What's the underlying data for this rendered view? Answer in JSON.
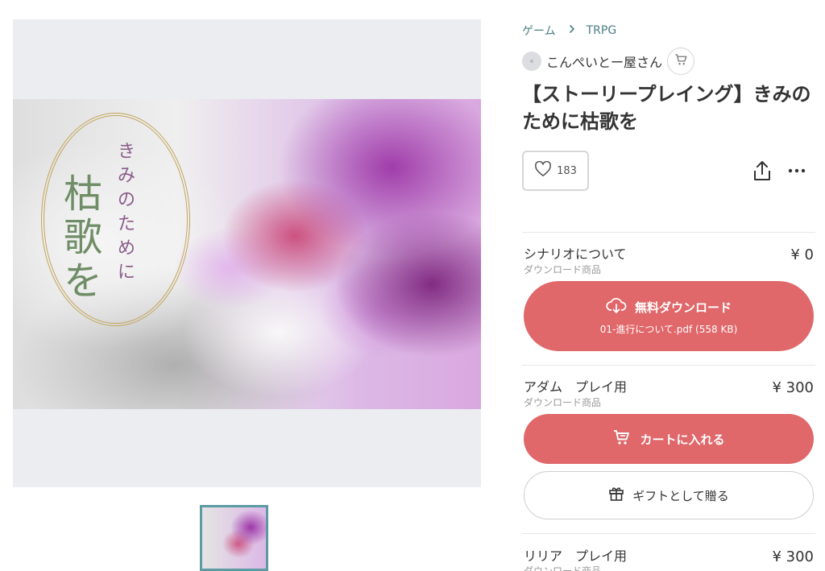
{
  "breadcrumb": {
    "parent": "ゲーム",
    "current": "TRPG"
  },
  "shop": {
    "name": "こんぺいとー屋さん"
  },
  "product": {
    "title": "【ストーリープレイング】きみのために枯歌を"
  },
  "likes": {
    "count": "183"
  },
  "image": {
    "title_big": "枯歌を",
    "title_small": "きみのために"
  },
  "items": [
    {
      "name": "シナリオについて",
      "type": "ダウンロード商品",
      "price": "¥ 0",
      "button_label": "無料ダウンロード",
      "button_sub": "01-進行について.pdf (558 KB)"
    },
    {
      "name": "アダム　プレイ用",
      "type": "ダウンロード商品",
      "price": "¥ 300",
      "button_label": "カートに入れる",
      "gift_label": "ギフトとして贈る"
    },
    {
      "name": "リリア　プレイ用",
      "type": "ダウンロード商品",
      "price": "¥ 300"
    }
  ],
  "colors": {
    "accent": "#e0676a",
    "link": "#4a7f86",
    "thumb_border": "#5b9ba3"
  },
  "icons": [
    "chevron-right-icon",
    "cart-icon",
    "heart-icon",
    "share-icon",
    "more-icon",
    "cloud-download-icon",
    "gift-icon"
  ]
}
